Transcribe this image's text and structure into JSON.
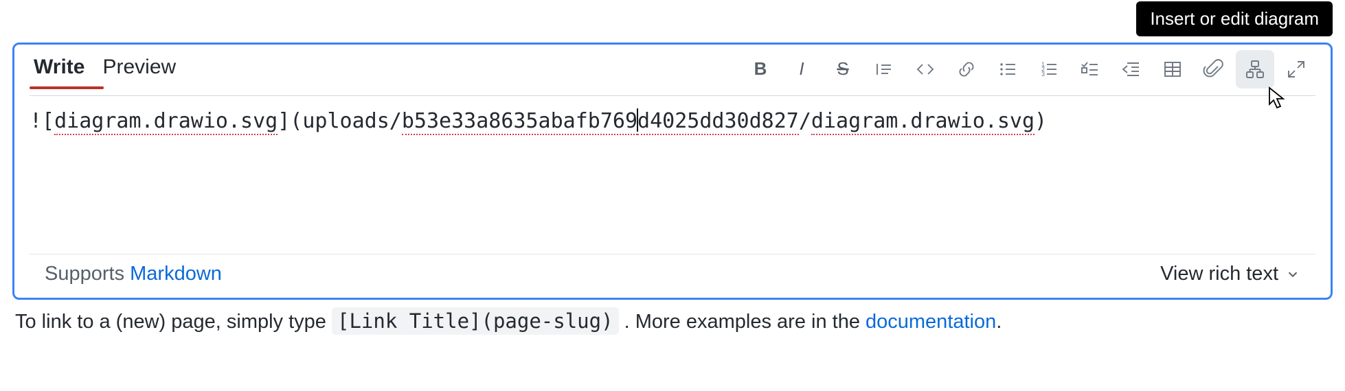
{
  "tooltip": "Insert or edit diagram",
  "tabs": {
    "write": "Write",
    "preview": "Preview"
  },
  "editor": {
    "content_parts": {
      "p1": "![",
      "p2": "diagram.drawio.svg",
      "p3": "](uploads/",
      "p4": "b53e33a8635abafb769",
      "p5": "d4025dd30d827",
      "p6": "/",
      "p7": "diagram.drawio.svg",
      "p8": ")"
    }
  },
  "footer": {
    "supports_prefix": "Supports ",
    "markdown_link": "Markdown",
    "richtext": "View rich text"
  },
  "help": {
    "pre": "To link to a (new) page, simply type ",
    "code": "[Link Title](page-slug)",
    "post": ". More examples are in the ",
    "doc_link": "documentation",
    "period": "."
  },
  "toolbar_buttons": [
    "bold",
    "italic",
    "strike",
    "quote",
    "code",
    "link",
    "ul",
    "ol",
    "task",
    "outdent",
    "table",
    "attach",
    "diagram",
    "fullscreen"
  ]
}
